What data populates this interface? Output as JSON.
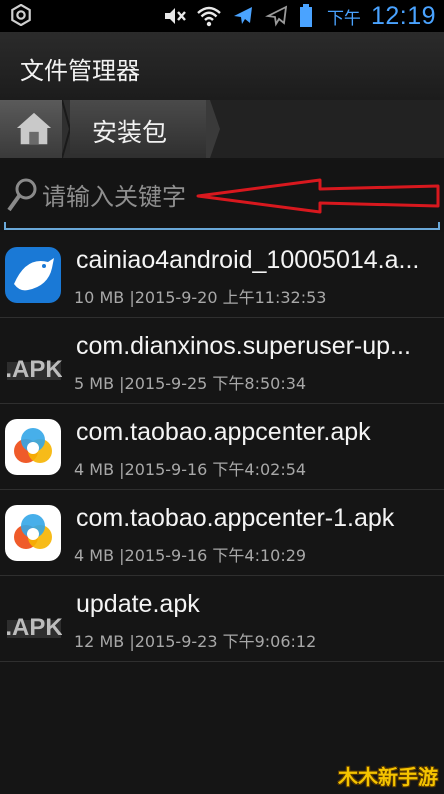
{
  "status_bar": {
    "ampm": "下午",
    "time": "12:19",
    "icons": [
      "settings-icon",
      "mute-icon",
      "wifi-icon",
      "airplane-icon",
      "airplane-outline-icon",
      "battery-icon"
    ],
    "accent": "#4aa3ff"
  },
  "app": {
    "title": "文件管理器"
  },
  "breadcrumb": {
    "home_icon": "home-icon",
    "current": "安装包"
  },
  "search": {
    "placeholder": "请输入关键字",
    "value": ""
  },
  "files": [
    {
      "name": "cainiao4android_10005014.a...",
      "meta": "10 MB |2015-9-20 上午11:32:53",
      "icon": "cainiao-app-icon"
    },
    {
      "name": "com.dianxinos.superuser-up...",
      "meta": "5 MB |2015-9-25 下午8:50:34",
      "icon": "apk-generic-icon"
    },
    {
      "name": "com.taobao.appcenter.apk",
      "meta": "4 MB |2015-9-16 下午4:02:54",
      "icon": "taobao-appcenter-icon"
    },
    {
      "name": "com.taobao.appcenter-1.apk",
      "meta": "4 MB |2015-9-16 下午4:10:29",
      "icon": "taobao-appcenter-icon"
    },
    {
      "name": "update.apk",
      "meta": "12 MB |2015-9-23 下午9:06:12",
      "icon": "apk-generic-icon"
    }
  ],
  "watermark": "木木新手游",
  "colors": {
    "annotation_arrow": "#d8181e",
    "search_underline": "#6aa8d8"
  }
}
